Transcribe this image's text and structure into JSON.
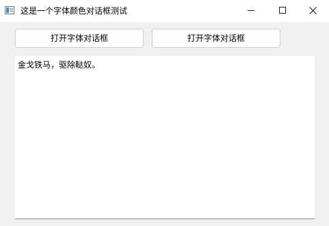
{
  "window": {
    "title": "这是一个字体颜色对话框测试"
  },
  "titlebar_icons": {
    "app": "app-window-icon",
    "minimize": "minimize-icon",
    "maximize": "maximize-icon",
    "close": "close-icon"
  },
  "buttons": {
    "open_font_dialog_1": "打开字体对话框",
    "open_font_dialog_2": "打开字体对话框"
  },
  "editor": {
    "text": "金戈铁马，驱除鞑奴。"
  }
}
